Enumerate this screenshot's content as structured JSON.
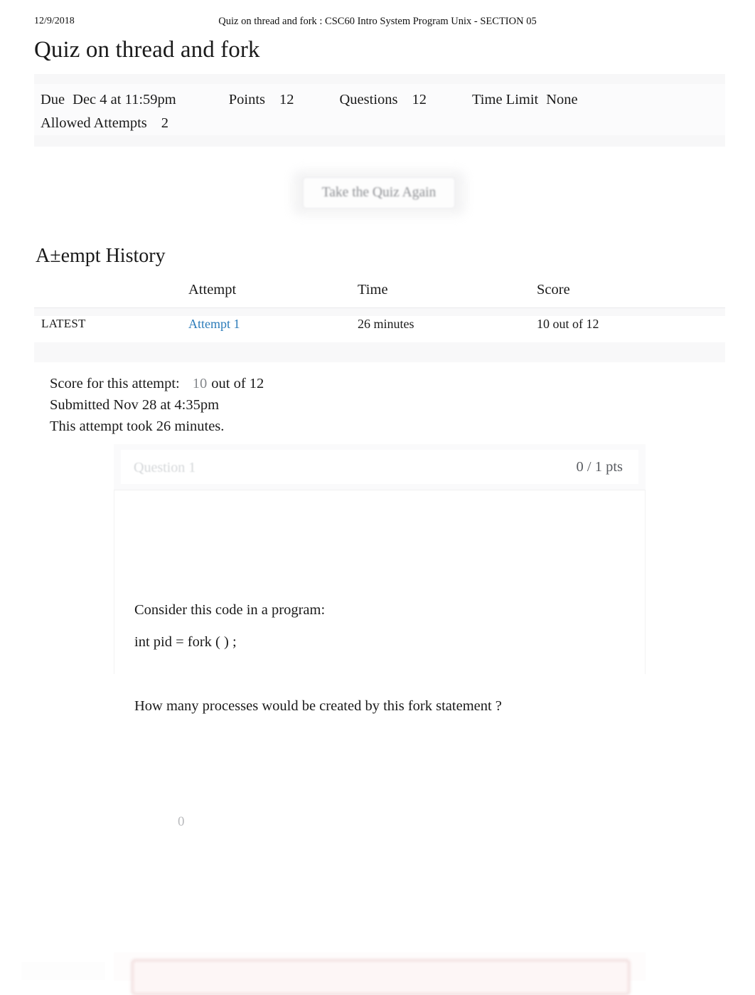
{
  "print": {
    "date": "12/9/2018",
    "header_title": "Quiz on thread and fork : CSC60 Intro System Program Unix - SECTION 05"
  },
  "page": {
    "title": "Quiz on thread and fork"
  },
  "quiz_meta": {
    "due_label": "Due",
    "due_value": "Dec 4 at 11:59pm",
    "points_label": "Points",
    "points_value": "12",
    "questions_label": "Questions",
    "questions_value": "12",
    "time_limit_label": "Time Limit",
    "time_limit_value": "None",
    "allowed_attempts_label": "Allowed Attempts",
    "allowed_attempts_value": "2"
  },
  "actions": {
    "retake_label": "Take the Quiz Again"
  },
  "attempt_history": {
    "heading": "A±empt History",
    "columns": [
      "",
      "Attempt",
      "Time",
      "Score"
    ],
    "rows": [
      {
        "marker": "LATEST",
        "attempt": "Attempt 1",
        "time": "26 minutes",
        "score": "10 out of 12"
      }
    ]
  },
  "score_summary": {
    "score_label": "Score for this attempt:",
    "score_value": "10",
    "score_out_of": "out of 12",
    "submitted": "Submitted Nov 28 at 4:35pm",
    "duration": "This attempt took 26 minutes."
  },
  "question": {
    "title": "Question 1",
    "points": "0 / 1 pts",
    "line1": "Consider this code in a program:",
    "line2": "int pid = fork  ( ) ;",
    "line3": "How many processes would be created by this fork statement ?",
    "answer_faint": "0"
  },
  "colors": {
    "link": "#2b7bb9",
    "muted": "#85888c",
    "wrong_border": "#e8c9c9",
    "wrong_bg": "#fdf6f6",
    "meta_band": "#f7f7f8"
  }
}
